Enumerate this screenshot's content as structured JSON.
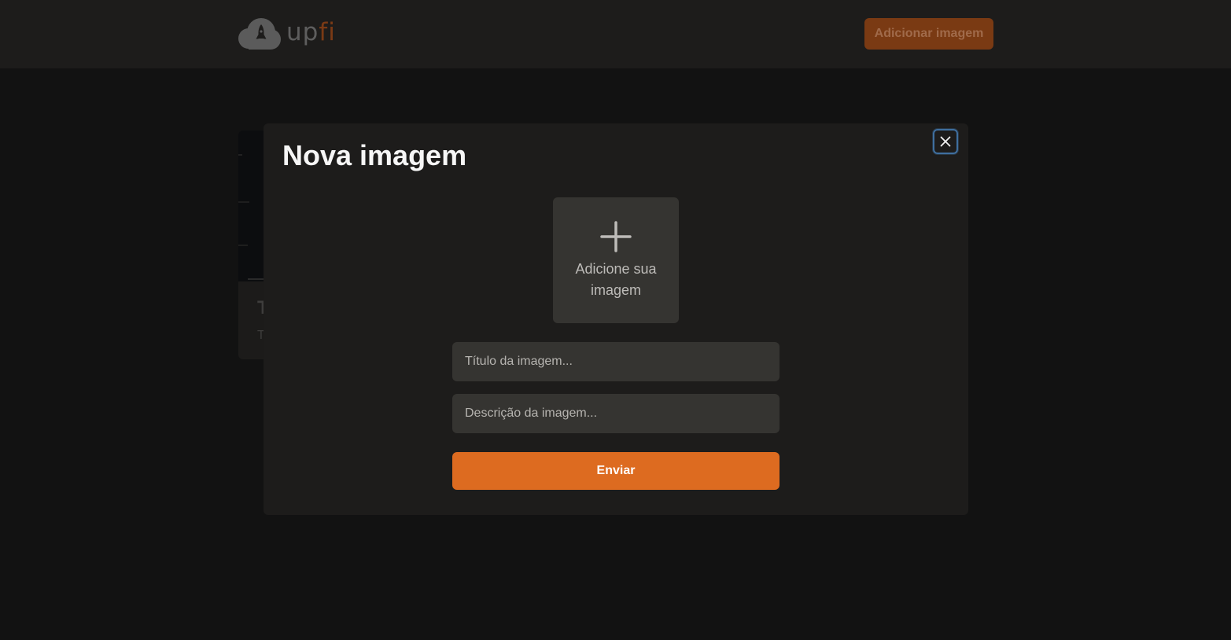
{
  "header": {
    "logo": {
      "up": "up",
      "fi": "fi"
    },
    "add_image_label": "Adicionar imagem"
  },
  "background_card": {
    "title": "T",
    "description": "T"
  },
  "modal": {
    "title": "Nova imagem",
    "close_icon": "close-icon",
    "upload": {
      "icon": "plus-icon",
      "label": "Adicione sua imagem"
    },
    "fields": {
      "title_placeholder": "Título da imagem...",
      "description_placeholder": "Descrição da imagem..."
    },
    "submit_label": "Enviar"
  },
  "colors": {
    "accent": "#dd6b20",
    "header_bg": "#1d1c1b",
    "page_bg": "#121212",
    "input_bg": "#353431",
    "focus_ring": "#3f6f9f"
  }
}
